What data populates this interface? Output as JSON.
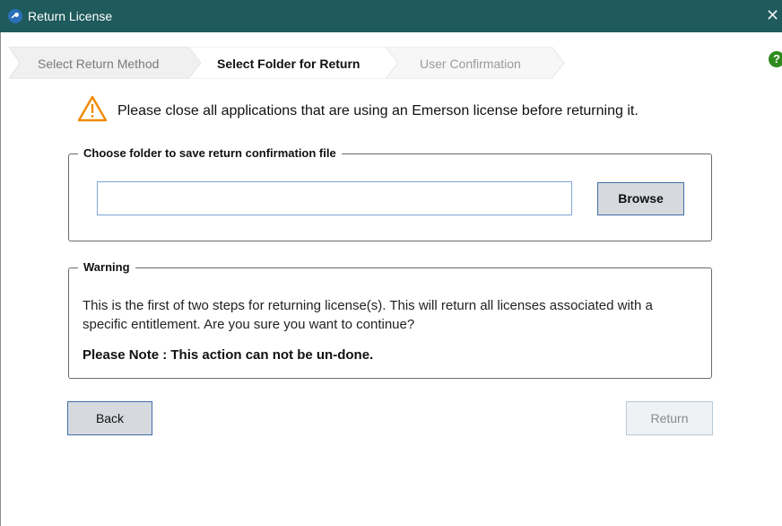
{
  "window": {
    "title": "Return License",
    "close_glyph": "✕",
    "app_icon": "key-icon"
  },
  "steps": [
    {
      "label": "Select Return Method",
      "state": "done"
    },
    {
      "label": "Select Folder for Return",
      "state": "active"
    },
    {
      "label": "User Confirmation",
      "state": "pending"
    }
  ],
  "help": {
    "glyph": "?",
    "icon": "help-icon"
  },
  "notice": {
    "icon": "warning-triangle-icon",
    "text": "Please close all applications that are using an Emerson license before returning it."
  },
  "folder_group": {
    "legend": "Choose folder to save return confirmation file",
    "input_value": "",
    "browse_label": "Browse"
  },
  "warning_group": {
    "legend": "Warning",
    "body": "This is the first of two steps for returning license(s). This will return all licenses associated with a specific entitlement. Are you sure you want to continue?",
    "note": "Please Note : This action can not be un-done."
  },
  "actions": {
    "back_label": "Back",
    "return_label": "Return",
    "return_enabled": false
  },
  "colors": {
    "titlebar": "#1f5a5c",
    "step_done_bg": "#f0f0f0",
    "step_active_bg": "#ffffff",
    "warning_icon": "#f08a00",
    "help_icon": "#2f8a1f"
  }
}
